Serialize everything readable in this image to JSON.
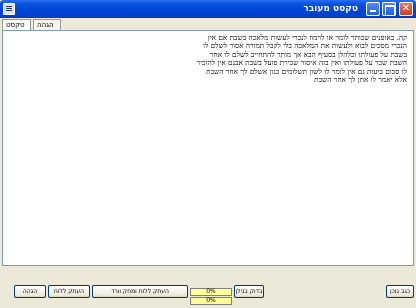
{
  "window": {
    "title": "טקסט מעובר"
  },
  "tabs": [
    {
      "label": "טקסט"
    },
    {
      "label": "הגהה"
    }
  ],
  "document": {
    "lines": [
      "קה. באופנים שכותר לומר או לרמוז לנכרי לעשות מלאכה בשבת אם אין",
      "הנכרי מסכים לבוא ולעשות את המלאכה בלי לקבל תמורה אסור לשלם לו",
      "בשבת על פעולתו וכלהלן בסעיף הבא אך מותר להתחייב לשלם לו אחר",
      "השבת שכר על פעולתו ואין בזה איסור שכירת פועל בשבת אבנם אין להזכיר",
      "לו סכום ביעות גם אין לומר לו לשון תשלומים כגון אשלם לך אחר השבת",
      "אלא יאמר לו אתן לך אחר השבת"
    ]
  },
  "progress": {
    "bar1": "0%",
    "bar2": "0%"
  },
  "buttons": {
    "pages": "כגב גוכן",
    "check": "בדוק בגילן",
    "copy_hd": "העתק ללוח ומחק וורד",
    "copy_clip": "העתק ללוח",
    "save": "הגהה"
  }
}
